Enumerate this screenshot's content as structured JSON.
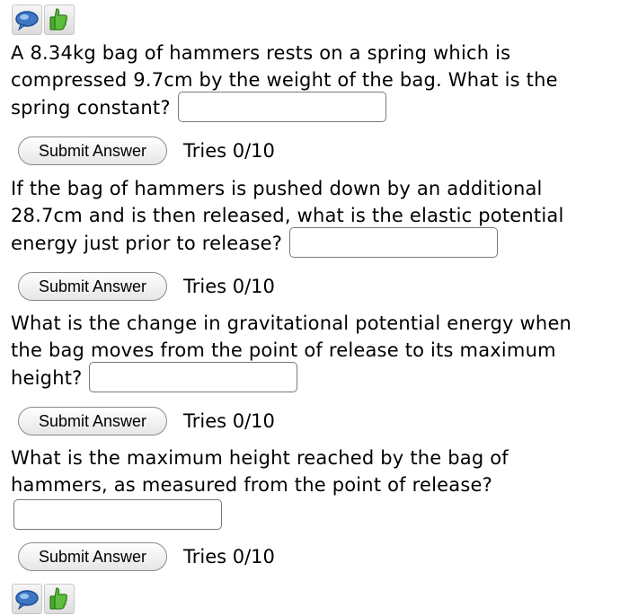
{
  "icons": {
    "top": [
      "discussion-icon",
      "thumbs-up-icon"
    ],
    "bottom": [
      "discussion-icon",
      "thumbs-up-icon"
    ]
  },
  "questions": [
    {
      "text": "A 8.34kg bag of hammers rests on a spring which is compressed 9.7cm by the weight of the bag. What is the spring constant?",
      "answer_value": "",
      "submit_label": "Submit Answer",
      "tries": "Tries 0/10"
    },
    {
      "text": "If the bag of hammers is pushed down by an additional 28.7cm and is then released, what is the elastic potential energy just prior to release?",
      "answer_value": "",
      "submit_label": "Submit Answer",
      "tries": "Tries 0/10"
    },
    {
      "text": "What is the change in gravitational potential energy when the bag moves from the point of release to its maximum height?",
      "answer_value": "",
      "submit_label": "Submit Answer",
      "tries": "Tries 0/10"
    },
    {
      "text": "What is the maximum height reached by the bag of hammers, as measured from the point of release?",
      "answer_value": "",
      "submit_label": "Submit Answer",
      "tries": "Tries 0/10"
    }
  ]
}
